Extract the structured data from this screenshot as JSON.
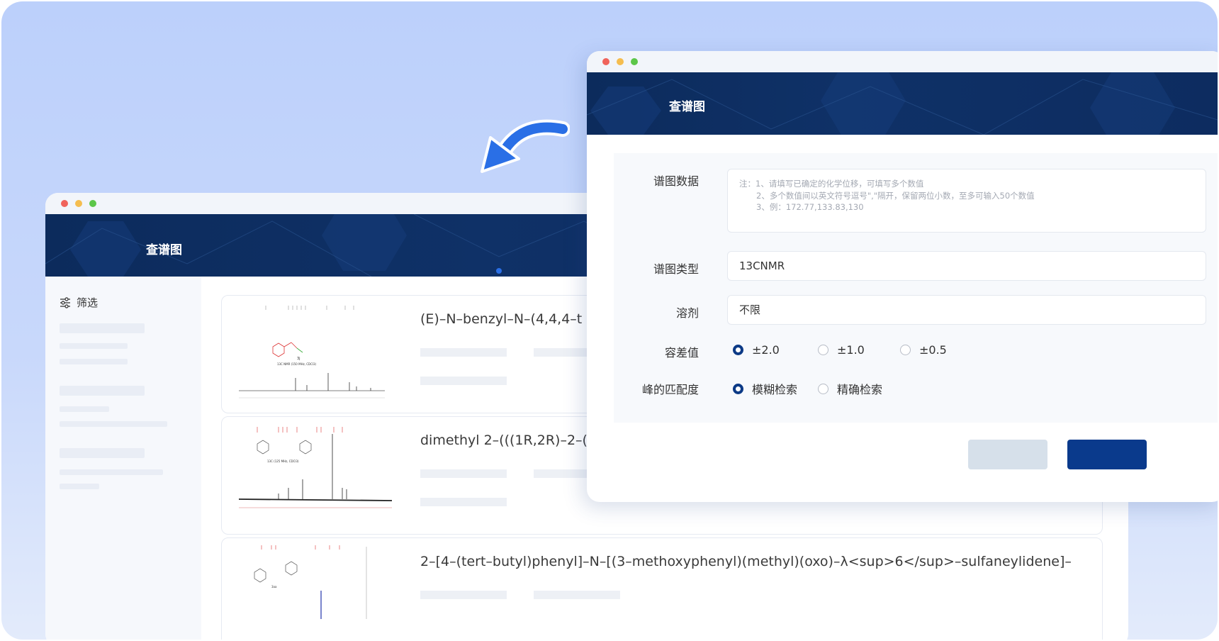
{
  "back_window": {
    "banner_title": "查谱图",
    "sidebar": {
      "filter_label": "筛选"
    },
    "results": [
      {
        "title": "(E)–N–benzyl–N–(4,4,4–t"
      },
      {
        "title": "dimethyl 2–(((1R,2R)–2–(("
      },
      {
        "title": "2–[4–(tert–butyl)phenyl]–N–[(3–methoxyphenyl)(methyl)(oxo)–λ<sup>6</sup>–sulfaneylidene]–"
      }
    ]
  },
  "front_window": {
    "banner_title": "查谱图",
    "form": {
      "spectrum_data_label": "谱图数据",
      "spectrum_data_notes": [
        "注：1、请填写已确定的化学位移，可填写多个数值",
        "2、多个数值间以英文符号逗号\",\"隔开，保留两位小数，至多可输入50个数值",
        "3、例：172.77,133.83,130"
      ],
      "spectrum_type_label": "谱图类型",
      "spectrum_type_value": "13CNMR",
      "solvent_label": "溶剂",
      "solvent_value": "不限",
      "tolerance_label": "容差值",
      "tolerance_options": [
        "±2.0",
        "±1.0",
        "±0.5"
      ],
      "tolerance_selected": "±2.0",
      "peak_match_label": "峰的匹配度",
      "peak_match_options": [
        "模糊检索",
        "精确检索"
      ],
      "peak_match_selected": "模糊检索"
    }
  },
  "colors": {
    "banner": "#0f3167",
    "accent": "#0a3a8c",
    "arrow": "#2a6fe6",
    "background": "#c4d5fb"
  }
}
